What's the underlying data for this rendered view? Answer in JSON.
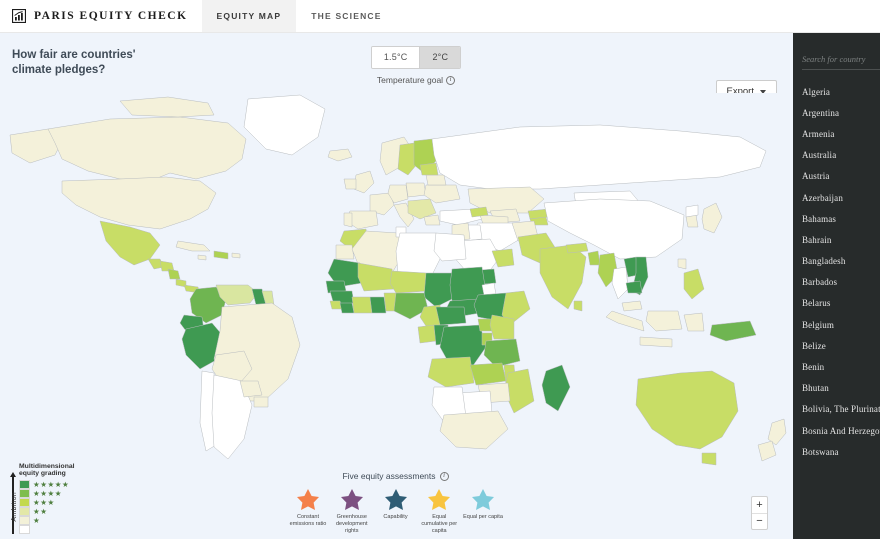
{
  "nav": {
    "brand": "PARIS EQUITY CHECK",
    "brand_icon": "bar-chart-icon",
    "tabs": [
      {
        "label": "EQUITY MAP",
        "active": true
      },
      {
        "label": "THE SCIENCE",
        "active": false
      }
    ]
  },
  "header": {
    "title": "How fair are countries'\nclimate pledges?",
    "temperature": {
      "options": [
        "1.5°C",
        "2°C"
      ],
      "selected": "2°C",
      "caption": "Temperature goal",
      "info_icon": "info-icon"
    },
    "export": {
      "label": "Export",
      "caret_icon": "chevron-down-icon"
    }
  },
  "sidebar": {
    "search_placeholder": "Search for country",
    "search_value": "",
    "countries": [
      "Algeria",
      "Argentina",
      "Armenia",
      "Australia",
      "Austria",
      "Azerbaijan",
      "Bahamas",
      "Bahrain",
      "Bangladesh",
      "Barbados",
      "Belarus",
      "Belgium",
      "Belize",
      "Benin",
      "Bhutan",
      "Bolivia, The Plurinational State Of",
      "Bosnia And Herzegovina",
      "Botswana"
    ]
  },
  "legend": {
    "axis_label": "Ambition",
    "title": "Multidimensional\nequity grading",
    "levels": [
      {
        "stars": 5,
        "color": "#3f9a52"
      },
      {
        "stars": 4,
        "color": "#7fbd4f"
      },
      {
        "stars": 3,
        "color": "#c3d94e"
      },
      {
        "stars": 2,
        "color": "#e3e8a8"
      },
      {
        "stars": 1,
        "color": "#f3f1d8"
      },
      {
        "stars": 0,
        "color": "#ffffff"
      }
    ],
    "star_glyph": "★"
  },
  "assessments": {
    "title": "Five equity assessments",
    "info_icon": "info-icon",
    "items": [
      {
        "label": "Constant emissions ratio",
        "color": "#f4804a",
        "icon": "star-icon"
      },
      {
        "label": "Greenhouse development rights",
        "color": "#7c5081",
        "icon": "star-icon"
      },
      {
        "label": "Capability",
        "color": "#2f5d75",
        "icon": "star-icon"
      },
      {
        "label": "Equal cumulative per capita",
        "color": "#f8c43f",
        "icon": "star-icon"
      },
      {
        "label": "Equal per capita",
        "color": "#7ecbdb",
        "icon": "star-icon"
      }
    ]
  },
  "zoom_controls": {
    "zoom_in": "+",
    "zoom_out": "−"
  },
  "map": {
    "ocean_color": "#eff4fb",
    "border_color": "#b8bcbf",
    "grade_colors": {
      "g5": "#3f9a52",
      "g4": "#6fb551",
      "g3": "#aed253",
      "g2": "#d9e6a0",
      "g1": "#f4f1da",
      "g0": "#ffffff"
    }
  }
}
